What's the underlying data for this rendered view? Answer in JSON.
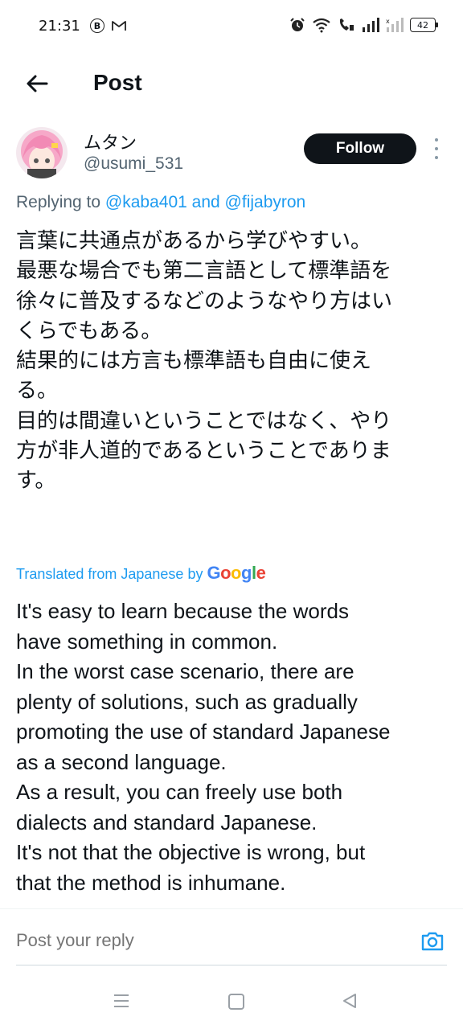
{
  "status_bar": {
    "time": "21:31",
    "left_icons": [
      "b-circle-icon",
      "gmail-icon"
    ],
    "right_icons": [
      "alarm-icon",
      "wifi-icon",
      "wifi-calling-icon",
      "signal-icon",
      "signal-no-service-icon"
    ],
    "battery": "42"
  },
  "header": {
    "back_icon": "arrow-left-icon",
    "title": "Post"
  },
  "post": {
    "display_name": "ムタン",
    "username": "@usumi_531",
    "follow_label": "Follow",
    "more_icon": "more-vertical-icon",
    "replying_to_prefix": "Replying to",
    "replying_to_user1": "@kaba401",
    "replying_to_and": "and",
    "replying_to_user2": "@fijabyron",
    "original_lines": [
      "言葉に共通点があるから学びやすい。",
      "最悪な場合でも第二言語として標準語を",
      "徐々に普及するなどのようなやり方はい",
      "くらでもある。",
      "結果的には方言も標準語も自由に使え",
      "る。",
      "目的は間違いということではなく、やり",
      "方が非人道的であるということでありま",
      "す。"
    ],
    "translated_prefix": "Translated from Japanese by",
    "translated_brand": "Google",
    "translation_lines": [
      "It's easy to learn because the words",
      "have something in common.",
      "In the worst case scenario, there are",
      "plenty of solutions, such as gradually",
      "promoting the use of standard Japanese",
      "as a second language.",
      "As a result, you can freely use both",
      "dialects and standard Japanese.",
      "It's not that the objective is wrong, but",
      "that the method is inhumane."
    ]
  },
  "reply_bar": {
    "placeholder": "Post your reply",
    "camera_icon": "camera-icon"
  },
  "nav_bar": {
    "icons": [
      "menu-icon",
      "home-square-icon",
      "back-triangle-icon"
    ]
  },
  "colors": {
    "accent": "#1d9bf0",
    "text": "#0f1419",
    "secondary_text": "#536471",
    "follow_bg": "#0f1419"
  }
}
